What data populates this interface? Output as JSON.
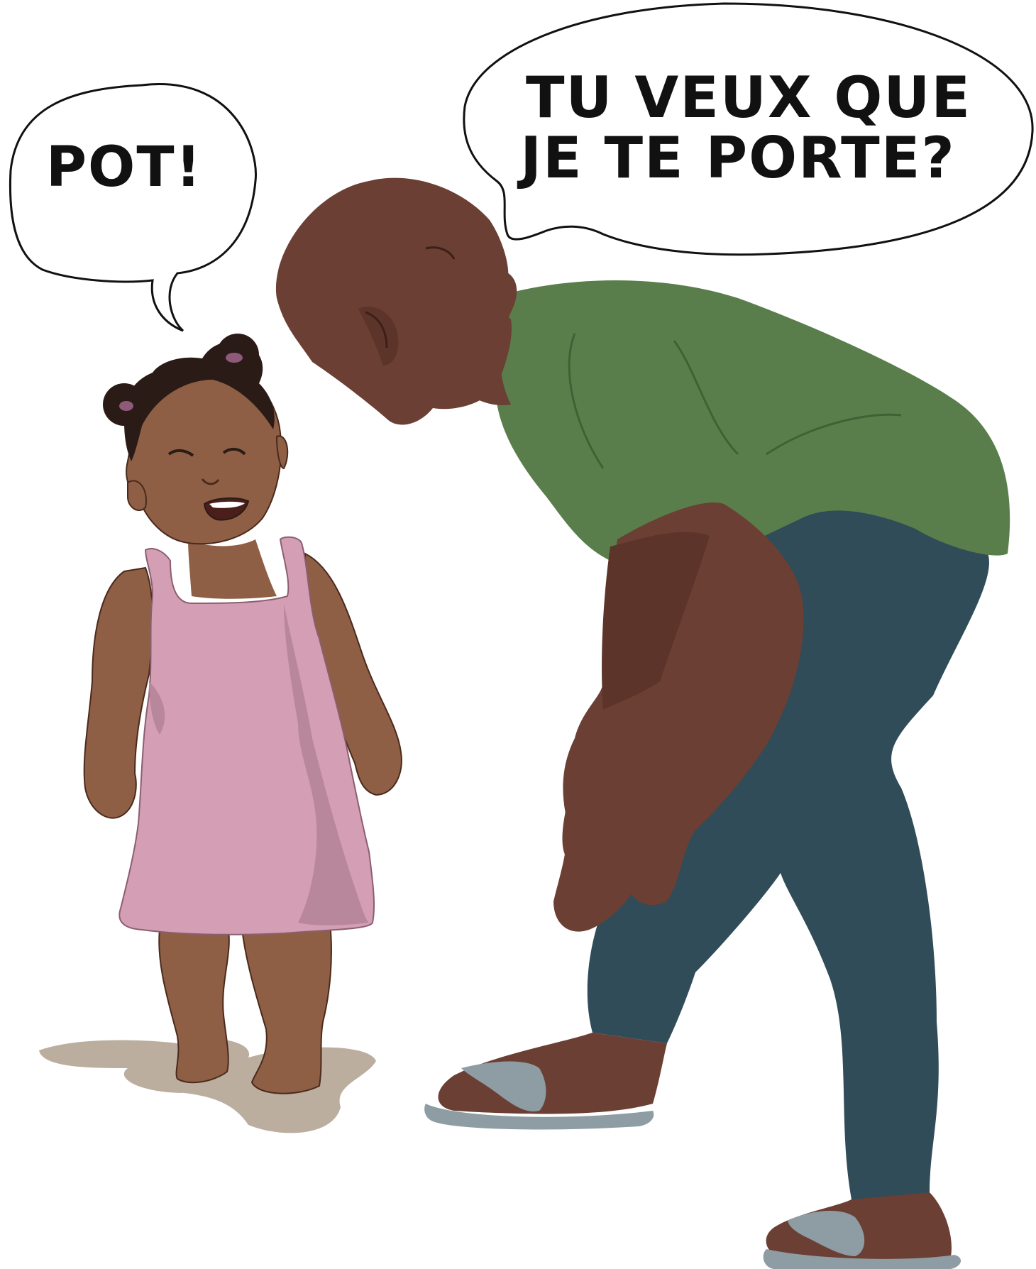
{
  "bubbles": {
    "child": {
      "text": "POT!"
    },
    "adult": {
      "line1": "TU VEUX QUE",
      "line2": "JE TE PORTE?"
    }
  },
  "colors": {
    "skin_child": "#8E5F45",
    "skin_adult": "#6B3F33",
    "dress": "#D49FB4",
    "dress_shade": "#B9879B",
    "shirt": "#5A7E4B",
    "jeans": "#2F4C58",
    "sandal": "#8E9CA3",
    "shadow": "#BBAE9F",
    "outline": "#111111"
  }
}
